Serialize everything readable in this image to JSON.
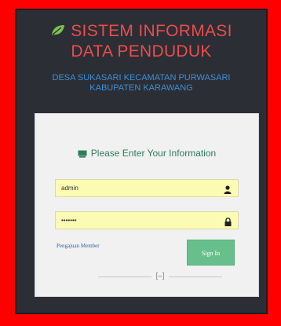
{
  "header": {
    "title_line1": "SISTEM INFORMASI",
    "title_line2": "DATA PENDUDUK",
    "subtitle_line1": "DESA SUKASARI KECAMATAN PURWASARI",
    "subtitle_line2": "KABUPATEN KARAWANG",
    "logo_icon": "leaf-icon"
  },
  "login": {
    "title": "Please Enter Your Information",
    "title_icon": "keyboard-icon",
    "username_value": "admin",
    "password_value": "•••••••",
    "user_icon": "user-icon",
    "lock_icon": "lock-icon",
    "register_link": "Pengajuan Member",
    "signin_label": "Sign In",
    "divider_text": "[–]"
  },
  "colors": {
    "frame": "#ff0000",
    "panel": "#2b2e35",
    "title": "#ea4d4d",
    "subtitle": "#3e8fd6",
    "accent": "#67c08b",
    "field_bg": "#fbfbb3"
  }
}
